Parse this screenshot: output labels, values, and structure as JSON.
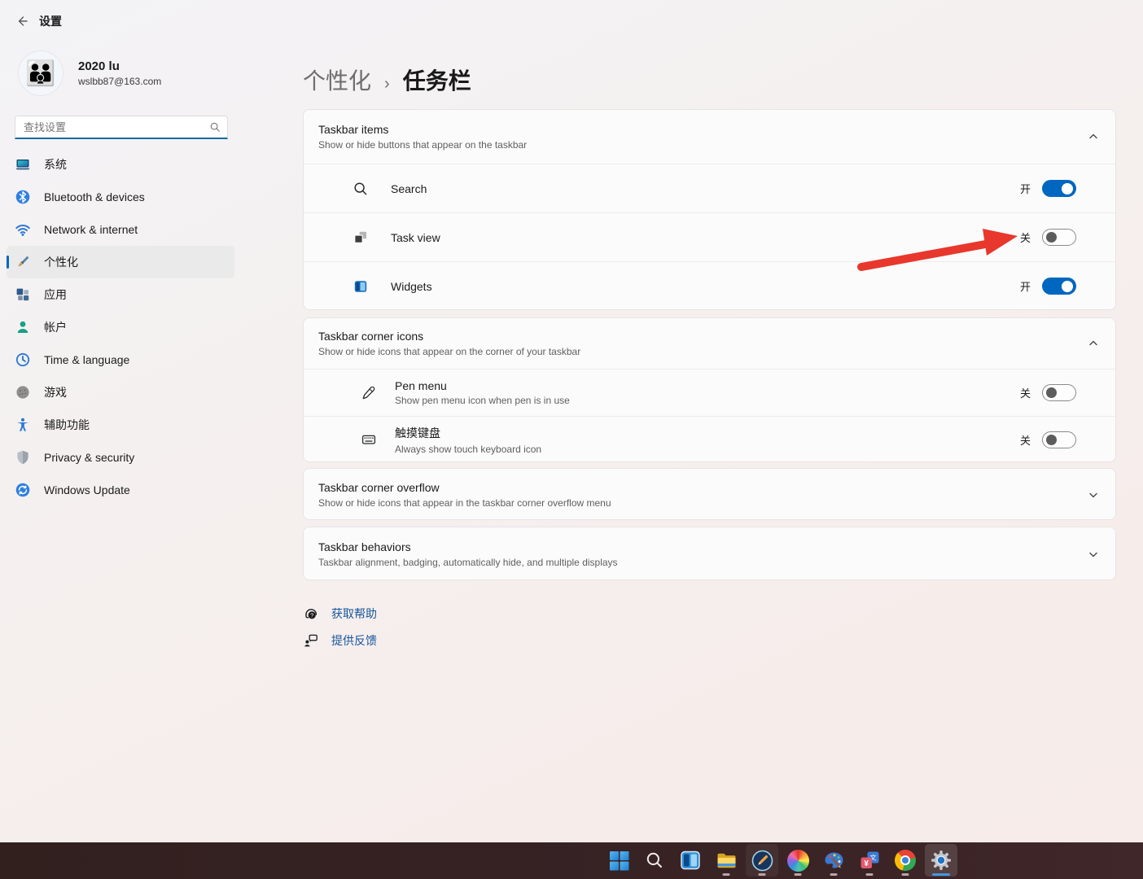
{
  "window": {
    "title": "设置"
  },
  "user": {
    "name": "2020 lu",
    "email": "wslbb87@163.com"
  },
  "search": {
    "placeholder": "查找设置"
  },
  "sidebar": {
    "items": [
      {
        "label": "系统",
        "icon": "system-icon",
        "selected": false
      },
      {
        "label": "Bluetooth & devices",
        "icon": "bluetooth-icon",
        "selected": false
      },
      {
        "label": "Network & internet",
        "icon": "network-icon",
        "selected": false
      },
      {
        "label": "个性化",
        "icon": "personalization-icon",
        "selected": true
      },
      {
        "label": "应用",
        "icon": "apps-icon",
        "selected": false
      },
      {
        "label": "帐户",
        "icon": "accounts-icon",
        "selected": false
      },
      {
        "label": "Time & language",
        "icon": "time-language-icon",
        "selected": false
      },
      {
        "label": "游戏",
        "icon": "gaming-icon",
        "selected": false
      },
      {
        "label": "辅助功能",
        "icon": "accessibility-icon",
        "selected": false
      },
      {
        "label": "Privacy & security",
        "icon": "privacy-icon",
        "selected": false
      },
      {
        "label": "Windows Update",
        "icon": "windows-update-icon",
        "selected": false
      }
    ]
  },
  "breadcrumb": {
    "parent": "个性化",
    "separator": "›",
    "current": "任务栏"
  },
  "sections": {
    "taskbar_items": {
      "title": "Taskbar items",
      "subtitle": "Show or hide buttons that appear on the taskbar",
      "expanded": true,
      "rows": [
        {
          "label": "Search",
          "icon": "search-icon",
          "state": "on",
          "state_label": "开"
        },
        {
          "label": "Task view",
          "icon": "task-view-icon",
          "state": "off",
          "state_label": "关"
        },
        {
          "label": "Widgets",
          "icon": "widgets-icon",
          "state": "on",
          "state_label": "开"
        }
      ]
    },
    "corner_icons": {
      "title": "Taskbar corner icons",
      "subtitle": "Show or hide icons that appear on the corner of your taskbar",
      "expanded": true,
      "rows": [
        {
          "label": "Pen menu",
          "subtitle": "Show pen menu icon when pen is in use",
          "icon": "pen-icon",
          "state": "off",
          "state_label": "关"
        },
        {
          "label": "触摸键盘",
          "subtitle": "Always show touch keyboard icon",
          "icon": "touch-keyboard-icon",
          "state": "off",
          "state_label": "关"
        }
      ]
    },
    "corner_overflow": {
      "title": "Taskbar corner overflow",
      "subtitle": "Show or hide icons that appear in the taskbar corner overflow menu",
      "expanded": false
    },
    "behaviors": {
      "title": "Taskbar behaviors",
      "subtitle": "Taskbar alignment, badging, automatically hide, and multiple displays",
      "expanded": false
    }
  },
  "links": {
    "help": "获取帮助",
    "feedback": "提供反馈"
  },
  "taskbar": {
    "icons": [
      "start",
      "search",
      "widgets",
      "file-explorer",
      "pen-app",
      "pinwheel-app",
      "paint-app",
      "translator-app",
      "chrome",
      "settings"
    ],
    "active_icon": "settings"
  },
  "colors": {
    "accent": "#0067c0",
    "link_blue": "#17559c",
    "taskbar_bg": "#372224",
    "arrow_red": "#e8372c",
    "card_bg": "#fbfbfb"
  }
}
